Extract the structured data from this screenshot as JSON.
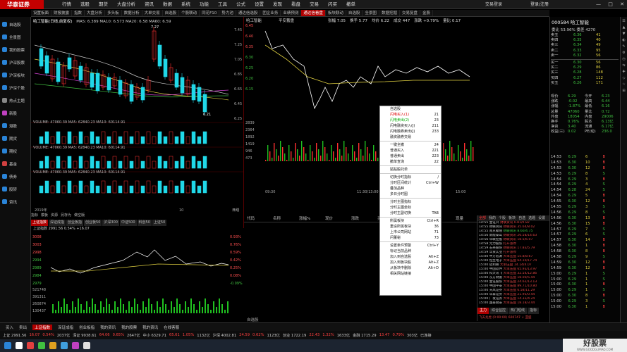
{
  "app": {
    "name": "华泰证券",
    "menu": [
      "行情",
      "选股",
      "期货",
      "大盘分析",
      "资讯",
      "数据",
      "系统",
      "功能",
      "工具",
      "公式",
      "设置",
      "发现",
      "看盘",
      "交易",
      "闪买",
      "撤单"
    ],
    "account_label": "交易登录",
    "login_label": "登录/注册",
    "window_controls": "— □ ✕"
  },
  "tabs": [
    "设置板面",
    "财报披露",
    "指数",
    "大盘分析",
    "多头板",
    "数据分析",
    "大单交易",
    "自选股",
    "个股联动",
    "同花F10",
    "势力池",
    "通达信选股",
    "团企业务",
    "业绩预测",
    "通达信看盘",
    "板块联动",
    "自选股",
    "全景图",
    "数据挖掘",
    "交易复盘",
    "金股"
  ],
  "active_tab_index": 14,
  "sidebar": [
    {
      "label": "自选股",
      "color": "#2a84d8"
    },
    {
      "label": "全景图",
      "color": "#2a84d8"
    },
    {
      "label": "我的股票",
      "color": "#2a84d8"
    },
    {
      "label": "沪深股票",
      "color": "#2a84d8"
    },
    {
      "label": "沪深板块",
      "color": "#2a84d8"
    },
    {
      "label": "沪深个股",
      "color": "#2a84d8"
    },
    {
      "label": "热点主题",
      "color": "#888888"
    },
    {
      "label": "新股",
      "color": "#c040c0"
    },
    {
      "label": "港股",
      "color": "#2a84d8"
    },
    {
      "label": "期货",
      "color": "#2a84d8"
    },
    {
      "label": "期权",
      "color": "#2a84d8"
    },
    {
      "label": "基金",
      "color": "#d04040"
    },
    {
      "label": "债券",
      "color": "#2a84d8"
    },
    {
      "label": "股转",
      "color": "#2a84d8"
    },
    {
      "label": "资讯",
      "color": "#2a84d8"
    }
  ],
  "kline": {
    "title": "哈工智能(日线,前复权)",
    "ma_line": "MA5: 6.389 MA10: 6.573 MA20: 6.58 MA60: 6.59",
    "high_label": "7.27",
    "low_label": "6.21",
    "vol_lines": [
      "VOLUME: 47060.39 MA5: 62840.23 MA10: 60114.91",
      "VOLUME: 47060.39 MA5: 62840.23 MA10: 60114.91",
      "VOLUME: 47060.39 MA5: 62840.23 MA10: 60114.91"
    ],
    "price_axis": [
      "7.45",
      "7.25",
      "7.05",
      "6.85",
      "6.65",
      "6.45",
      "6.25"
    ],
    "bottom_tabs": [
      "指标",
      "模板",
      "资源",
      "另存为",
      "做空版"
    ],
    "period_label": "日线",
    "date_start": "2019年",
    "date_end": "10"
  },
  "index_tabs": [
    "上证指数",
    "深证成指",
    "创业板指",
    "创业板50",
    "沪深300",
    "中证500",
    "科创50",
    "上证50"
  ],
  "index_active": 0,
  "index_info": "上证指数  2991.56  0.54%  +16.07",
  "index_axis": [
    "3008",
    "3003",
    "2998",
    "2994",
    "2989",
    "2984",
    "2979"
  ],
  "index_pct": [
    "0.93%",
    "0.76%",
    "0.59%",
    "0.42%",
    "0.25%",
    "0.08%",
    "-0.09%"
  ],
  "vol_axis": [
    "521748",
    "391311",
    "260874",
    "130437"
  ],
  "intraday": {
    "code": "哈工智能",
    "tag": "平安蓄盘",
    "stats": [
      "张幅 7.05",
      "换手 5.77",
      "均价 6.22",
      "成交 447",
      "涨跌 +0.79%",
      "量比 0.17"
    ],
    "price_axis": [
      "6.45",
      "6.40",
      "6.35",
      "6.30",
      "6.25",
      "6.20",
      "6.15"
    ],
    "vol_axis": [
      "2839",
      "2364",
      "1892",
      "1419",
      "946",
      "473"
    ],
    "times": [
      "09:30",
      "11:30/13:00",
      "15:00"
    ]
  },
  "grid": {
    "headers": [
      "代码",
      "名称",
      "涨幅%",
      "现价",
      "涨跌",
      "买价",
      "卖价",
      "总量",
      "现量"
    ],
    "bottom_tab": "自选股"
  },
  "context_menu": [
    {
      "label": "自选股",
      "key": "",
      "style": ""
    },
    {
      "label": "闪电买入(1)",
      "key": "21",
      "style": "red"
    },
    {
      "label": "闪电卖出(2)",
      "key": "23",
      "style": "green"
    },
    {
      "label": "闪电融资买入(J)",
      "key": "211",
      "style": ""
    },
    {
      "label": "闪电融券卖出(J)",
      "key": "233",
      "style": ""
    },
    {
      "label": "融资融券交易",
      "key": "",
      "style": ""
    },
    {
      "label": "---",
      "key": "",
      "style": ""
    },
    {
      "label": "一键全撤",
      "key": "24",
      "style": ""
    },
    {
      "label": "普通买入",
      "key": "221",
      "style": ""
    },
    {
      "label": "普通卖出",
      "key": "223",
      "style": ""
    },
    {
      "label": "撤单查询",
      "key": "22",
      "style": ""
    },
    {
      "label": "---",
      "key": "",
      "style": ""
    },
    {
      "label": "贴贴股托单",
      "key": "",
      "style": ""
    },
    {
      "label": "---",
      "key": "",
      "style": ""
    },
    {
      "label": "切换分时指标",
      "key": "/",
      "style": ""
    },
    {
      "label": "分时区间统计",
      "key": "Ctrl+W",
      "style": ""
    },
    {
      "label": "叠加品种",
      "key": "",
      "style": ""
    },
    {
      "label": "多日分时图",
      "key": "",
      "style": ""
    },
    {
      "label": "---",
      "key": "",
      "style": ""
    },
    {
      "label": "分时主图指标",
      "key": "",
      "style": ""
    },
    {
      "label": "分时主图坐标",
      "key": "",
      "style": ""
    },
    {
      "label": "分时主副切换",
      "key": "TAB",
      "style": ""
    },
    {
      "label": "---",
      "key": "",
      "style": ""
    },
    {
      "label": "所属板块",
      "key": "Ctrl+R",
      "style": ""
    },
    {
      "label": "重设所属板块",
      "key": "36",
      "style": ""
    },
    {
      "label": "上市公司网站",
      "key": "71",
      "style": ""
    },
    {
      "label": "问董秘",
      "key": "73",
      "style": ""
    },
    {
      "label": "---",
      "key": "",
      "style": ""
    },
    {
      "label": "设置条件预警",
      "key": "Ctrl+Y",
      "style": ""
    },
    {
      "label": "标记当前品种",
      "key": "",
      "style": ""
    },
    {
      "label": "加入到自选股",
      "key": "Alt+Z",
      "style": ""
    },
    {
      "label": "加入到板块股",
      "key": "Alt+Z",
      "style": ""
    },
    {
      "label": "从板块中删除",
      "key": "Alt+D",
      "style": ""
    },
    {
      "label": "相关网站链接",
      "key": "",
      "style": ""
    }
  ],
  "quote": {
    "code_name": "000584 哈工智能",
    "ratio": "委比 53.96%  委差 4270",
    "sell": [
      [
        "卖五",
        "6.36",
        "41"
      ],
      [
        "卖四",
        "6.35",
        "40"
      ],
      [
        "卖三",
        "6.34",
        "49"
      ],
      [
        "卖二",
        "6.33",
        "95"
      ],
      [
        "卖一",
        "6.32",
        "56"
      ]
    ],
    "buy": [
      [
        "买一",
        "6.30",
        "56"
      ],
      [
        "买二",
        "6.29",
        "86"
      ],
      [
        "买三",
        "6.28",
        "148"
      ],
      [
        "买四",
        "6.27",
        "112"
      ],
      [
        "买五",
        "6.26",
        "171"
      ]
    ],
    "stats": [
      [
        "现价",
        "6.29",
        "今开",
        "6.23"
      ],
      [
        "涨跌",
        "-0.02",
        "最高",
        "6.44"
      ],
      [
        "涨幅",
        "-1.87%",
        "最低",
        "6.16"
      ],
      [
        "总量",
        "47060",
        "量比",
        "0.72"
      ],
      [
        "外盘",
        "18054",
        "内盘",
        "29006"
      ],
      [
        "换手",
        "0.76%",
        "股本",
        "6.13亿"
      ],
      [
        "净资",
        "3.40",
        "流通",
        "6.17亿"
      ],
      [
        "收益(三)",
        "0.02",
        "PE(动)",
        "236.0"
      ]
    ]
  },
  "ticks": [
    [
      "14:53",
      "6.29",
      "6",
      "B"
    ],
    [
      "14:53",
      "6.30",
      "10",
      "B"
    ],
    [
      "14:53",
      "6.30",
      "12",
      "B"
    ],
    [
      "14:53",
      "6.29",
      "8",
      "S"
    ],
    [
      "14:54",
      "6.29",
      "3",
      "B"
    ],
    [
      "14:54",
      "6.29",
      "4",
      "S"
    ],
    [
      "14:54",
      "6.28",
      "24",
      "S"
    ],
    [
      "14:54",
      "6.29",
      "5",
      "B"
    ],
    [
      "14:55",
      "6.30",
      "12",
      "B"
    ],
    [
      "14:55",
      "6.29",
      "3",
      "S"
    ],
    [
      "14:56",
      "6.29",
      "8",
      "S"
    ],
    [
      "14:56",
      "6.30",
      "13",
      "B"
    ],
    [
      "14:56",
      "6.30",
      "15",
      "B"
    ],
    [
      "14:57",
      "6.29",
      "7",
      "S"
    ],
    [
      "14:57",
      "6.29",
      "6",
      "S"
    ],
    [
      "14:57",
      "6.30",
      "14",
      "B"
    ],
    [
      "14:58",
      "6.30",
      "1",
      "B"
    ],
    [
      "14:58",
      "6.30",
      "8",
      "B"
    ],
    [
      "14:58",
      "6.29",
      "9",
      "S"
    ],
    [
      "14:59",
      "6.30",
      "12",
      "B"
    ],
    [
      "14:59",
      "6.30",
      "12",
      "B"
    ],
    [
      "15:00",
      "6.29",
      "1",
      "S"
    ],
    [
      "15:00",
      "6.29",
      "1",
      "S"
    ],
    [
      "15:00",
      "6.30",
      "1",
      "B"
    ],
    [
      "15:00",
      "6.29",
      "1",
      "S"
    ],
    [
      "15:00",
      "6.30",
      "8",
      "B"
    ],
    [
      "15:00",
      "6.29",
      "3",
      "S"
    ],
    [
      "15:00",
      "6.30",
      "1",
      "B"
    ]
  ],
  "news": {
    "tabs": [
      "全部",
      "我的",
      "个股",
      "板块",
      "自选",
      "选题",
      "设置"
    ],
    "rows": [
      {
        "t": "14:55 金证兴",
        "d": "财联资讯 0.81/0.82",
        "c": "#dd4444"
      },
      {
        "t": "14:55 财联资讯",
        "d": "财联资讯 35.64/8.02",
        "c": "#dd4444"
      },
      {
        "t": "14:55 南京聚隆",
        "d": "财联资讯 8.60/4.75",
        "c": "#44cc44"
      },
      {
        "t": "14:56 新能泰山",
        "d": "财联资讯 26.58/14.63",
        "c": "#dd4444"
      },
      {
        "t": "14:56 华联控股",
        "d": "财联资讯 18.5/6.07",
        "c": "#dd4444"
      },
      {
        "t": "14:58 元力股份",
        "d": "打开涨停",
        "c": "#dd4444"
      },
      {
        "t": "14:59 石英股份",
        "d": "财联资讯 17.83/5.79",
        "c": "#dd4444"
      },
      {
        "t": "14:59 华资实业",
        "d": "打开涨停",
        "c": "#dd4444"
      },
      {
        "t": "15:00 申万宏源",
        "d": "大单压盘 15.8/8.67",
        "c": "#dd4444"
      },
      {
        "t": "15:00 恒生电子",
        "d": "大单压盘 64.10/17.74",
        "c": "#dd4444"
      },
      {
        "t": "15:00 佰利联",
        "d": "大单压盘 14.14/4.07",
        "c": "#dd4444"
      },
      {
        "t": "15:00 中国软件",
        "d": "大单压盘 65.93/13.97",
        "c": "#dd4444"
      },
      {
        "t": "15:00 科大讯飞",
        "d": "大单压盘 32.54/12.86",
        "c": "#dd4444"
      },
      {
        "t": "15:00 东方财富",
        "d": "大单压盘 18.00/5.44",
        "c": "#dd4444"
      },
      {
        "t": "15:00 金证股份",
        "d": "大单压盘 24.62/13.13",
        "c": "#dd4444"
      },
      {
        "t": "15:00 中国平安",
        "d": "大单压盘 89.71/10.80",
        "c": "#dd4444"
      },
      {
        "t": "15:00 天风证券",
        "d": "大单压盘 6.58/11.29",
        "c": "#dd4444"
      },
      {
        "t": "15:00 华泰证券",
        "d": "大单压盘 21.95/0.44",
        "c": "#dd4444"
      },
      {
        "t": "15:00 广发证券",
        "d": "大单压盘 14.33/4.24",
        "c": "#dd4444"
      },
      {
        "t": "15:00 国泰君安",
        "d": "大单压盘 18.18/3.44",
        "c": "#dd4444"
      }
    ],
    "foot_tabs": [
      "主力",
      "综合监控",
      "热门短线",
      "指标"
    ],
    "foot_active": 0,
    "ticker": "飞天龙虎 (0:00:00) 600747 ↓ 亚盛"
  },
  "status1": [
    {
      "label": "买入",
      "act": false
    },
    {
      "label": "卖出",
      "act": false
    },
    {
      "label": "上证指数",
      "act": true
    },
    {
      "label": "深证成指",
      "act": false
    },
    {
      "label": "创业板指",
      "act": false
    },
    {
      "label": "我的资讯",
      "act": false
    },
    {
      "label": "我的股票",
      "act": false
    },
    {
      "label": "我的资讯",
      "act": false
    },
    {
      "label": "在线客服",
      "act": false
    }
  ],
  "status2": [
    "上证 2991.56",
    "16.07",
    "0.54%",
    "2037亿",
    "深证 9938.61",
    "64.06",
    "0.65%",
    "2647亿",
    "中小 6329.71",
    "65.61",
    "1.05%",
    "1132亿",
    "沪深 4002.81",
    "24.59",
    "0.62%",
    "1123亿",
    "创业 1722.19",
    "22.43",
    "1.32%",
    "1633亿",
    "金融 1715.29",
    "13.47",
    "0.79%",
    "303亿",
    "已连接"
  ],
  "watermark": {
    "title": "好股票",
    "sub": "WWW.GOODGUPIAO.COM"
  }
}
